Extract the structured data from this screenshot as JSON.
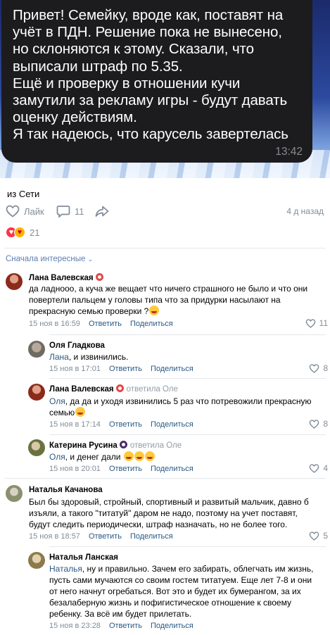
{
  "message": {
    "text": "Привет! Семейку, вроде как, поставят на\nучёт в ПДН. Решение пока не вынесено,\nно склоняются к этому. Сказали, что\nвыписали штраф по 5.35.\nЕщё и проверку в отношении кучи\nзамутили за рекламу игры - будут давать\nоценку действиям.\nЯ так надеюсь, что карусель завертелась",
    "time": "13:42"
  },
  "post": {
    "caption": "из Сети",
    "like_label": "Лайк",
    "comments_count": "11",
    "time_ago": "4 д назад",
    "reactions_count": "21"
  },
  "sort_label": "Сначала интересные",
  "comments": [
    {
      "author": "Лана Валевская",
      "text": "да ладнооо, а куча же вещает что ничего страшного не было и что они повертели пальцем у головы типа что за придурки насылают на прекрасную семью проверки ?",
      "date": "15 ноя в 16:59",
      "reply": "Ответить",
      "share": "Поделиться",
      "likes": "11"
    },
    {
      "author": "Оля Гладкова",
      "to": "Лана",
      "text": ", и извинились.",
      "date": "15 ноя в 17:01",
      "reply": "Ответить",
      "share": "Поделиться",
      "likes": "8"
    },
    {
      "author": "Лана Валевская",
      "replied_to": "ответила Оле",
      "to": "Оля",
      "text": ", да да и уходя извинились 5 раз что потревожили прекрасную семью",
      "date": "15 ноя в 17:14",
      "reply": "Ответить",
      "share": "Поделиться",
      "likes": "8"
    },
    {
      "author": "Катерина Русина",
      "replied_to": "ответила Оле",
      "to": "Оля",
      "text": ", и денег дали",
      "date": "15 ноя в 20:01",
      "reply": "Ответить",
      "share": "Поделиться",
      "likes": "4"
    },
    {
      "author": "Наталья Качанова",
      "text": "Был бы здоровый, стройный, спортивный и развитый мальчик, давно б изъяли, а такого \"титатуй\" даром не надо, поэтому на учет поставят, будут следить периодически, штраф назначать, но не более того.",
      "date": "15 ноя в 18:57",
      "reply": "Ответить",
      "share": "Поделиться",
      "likes": "5"
    },
    {
      "author": "Наталья Ланская",
      "to": "Наталья",
      "text": ", ну и правильно. Зачем его забирать, облегчать им жизнь, пусть сами мучаются со своим гостем титатуем. Еще лет 7-8 и они от него начнут огребаться. Вот это и будет их бумерангом, за их безалаберную жизнь и пофигистическое отношение к своему ребенку. За всё им будет прилетать.",
      "date": "15 ноя в 23:28",
      "reply": "Ответить",
      "share": "Поделиться"
    }
  ]
}
